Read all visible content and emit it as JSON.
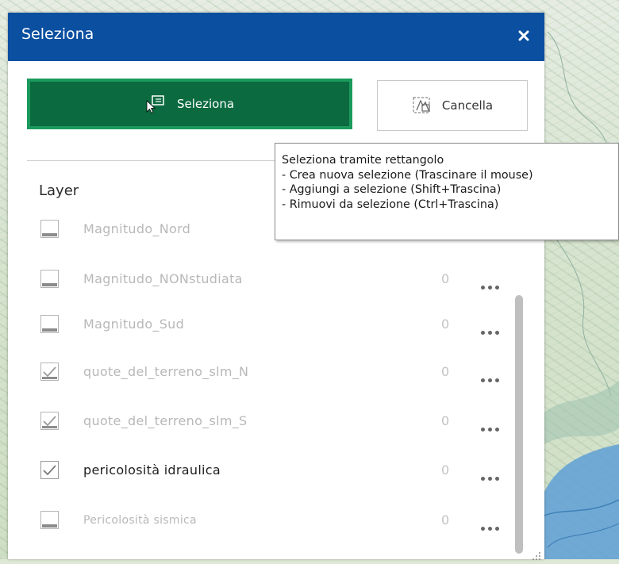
{
  "panel": {
    "title": "Seleziona",
    "close_icon": "close-icon",
    "select_button_label": "Seleziona",
    "clear_button_label": "Cancella",
    "layer_heading": "Layer"
  },
  "layers": [
    {
      "name": "Magnitudo_Nord",
      "count": "",
      "checked": false,
      "active": false
    },
    {
      "name": "Magnitudo_NONstudiata",
      "count": "0",
      "checked": false,
      "active": false
    },
    {
      "name": "Magnitudo_Sud",
      "count": "0",
      "checked": false,
      "active": false
    },
    {
      "name": "quote_del_terreno_slm_N",
      "count": "0",
      "checked": true,
      "active": false
    },
    {
      "name": "quote_del_terreno_slm_S",
      "count": "0",
      "checked": true,
      "active": false
    },
    {
      "name": "pericolosità idraulica",
      "count": "0",
      "checked": true,
      "active": true
    },
    {
      "name": "Pericolosità sismica",
      "count": "0",
      "checked": false,
      "active": false
    }
  ],
  "tooltip": {
    "title": "Seleziona tramite rettangolo",
    "lines": [
      "- Crea nuova selezione (Trascinare il mouse)",
      "- Aggiungi a selezione (Shift+Trascina)",
      "- Rimuovi da selezione (Ctrl+Trascina)"
    ]
  },
  "colors": {
    "title_bar": "#0a4fa0",
    "select_button": "#0b6a3f",
    "select_button_border": "#1a9a5c"
  }
}
